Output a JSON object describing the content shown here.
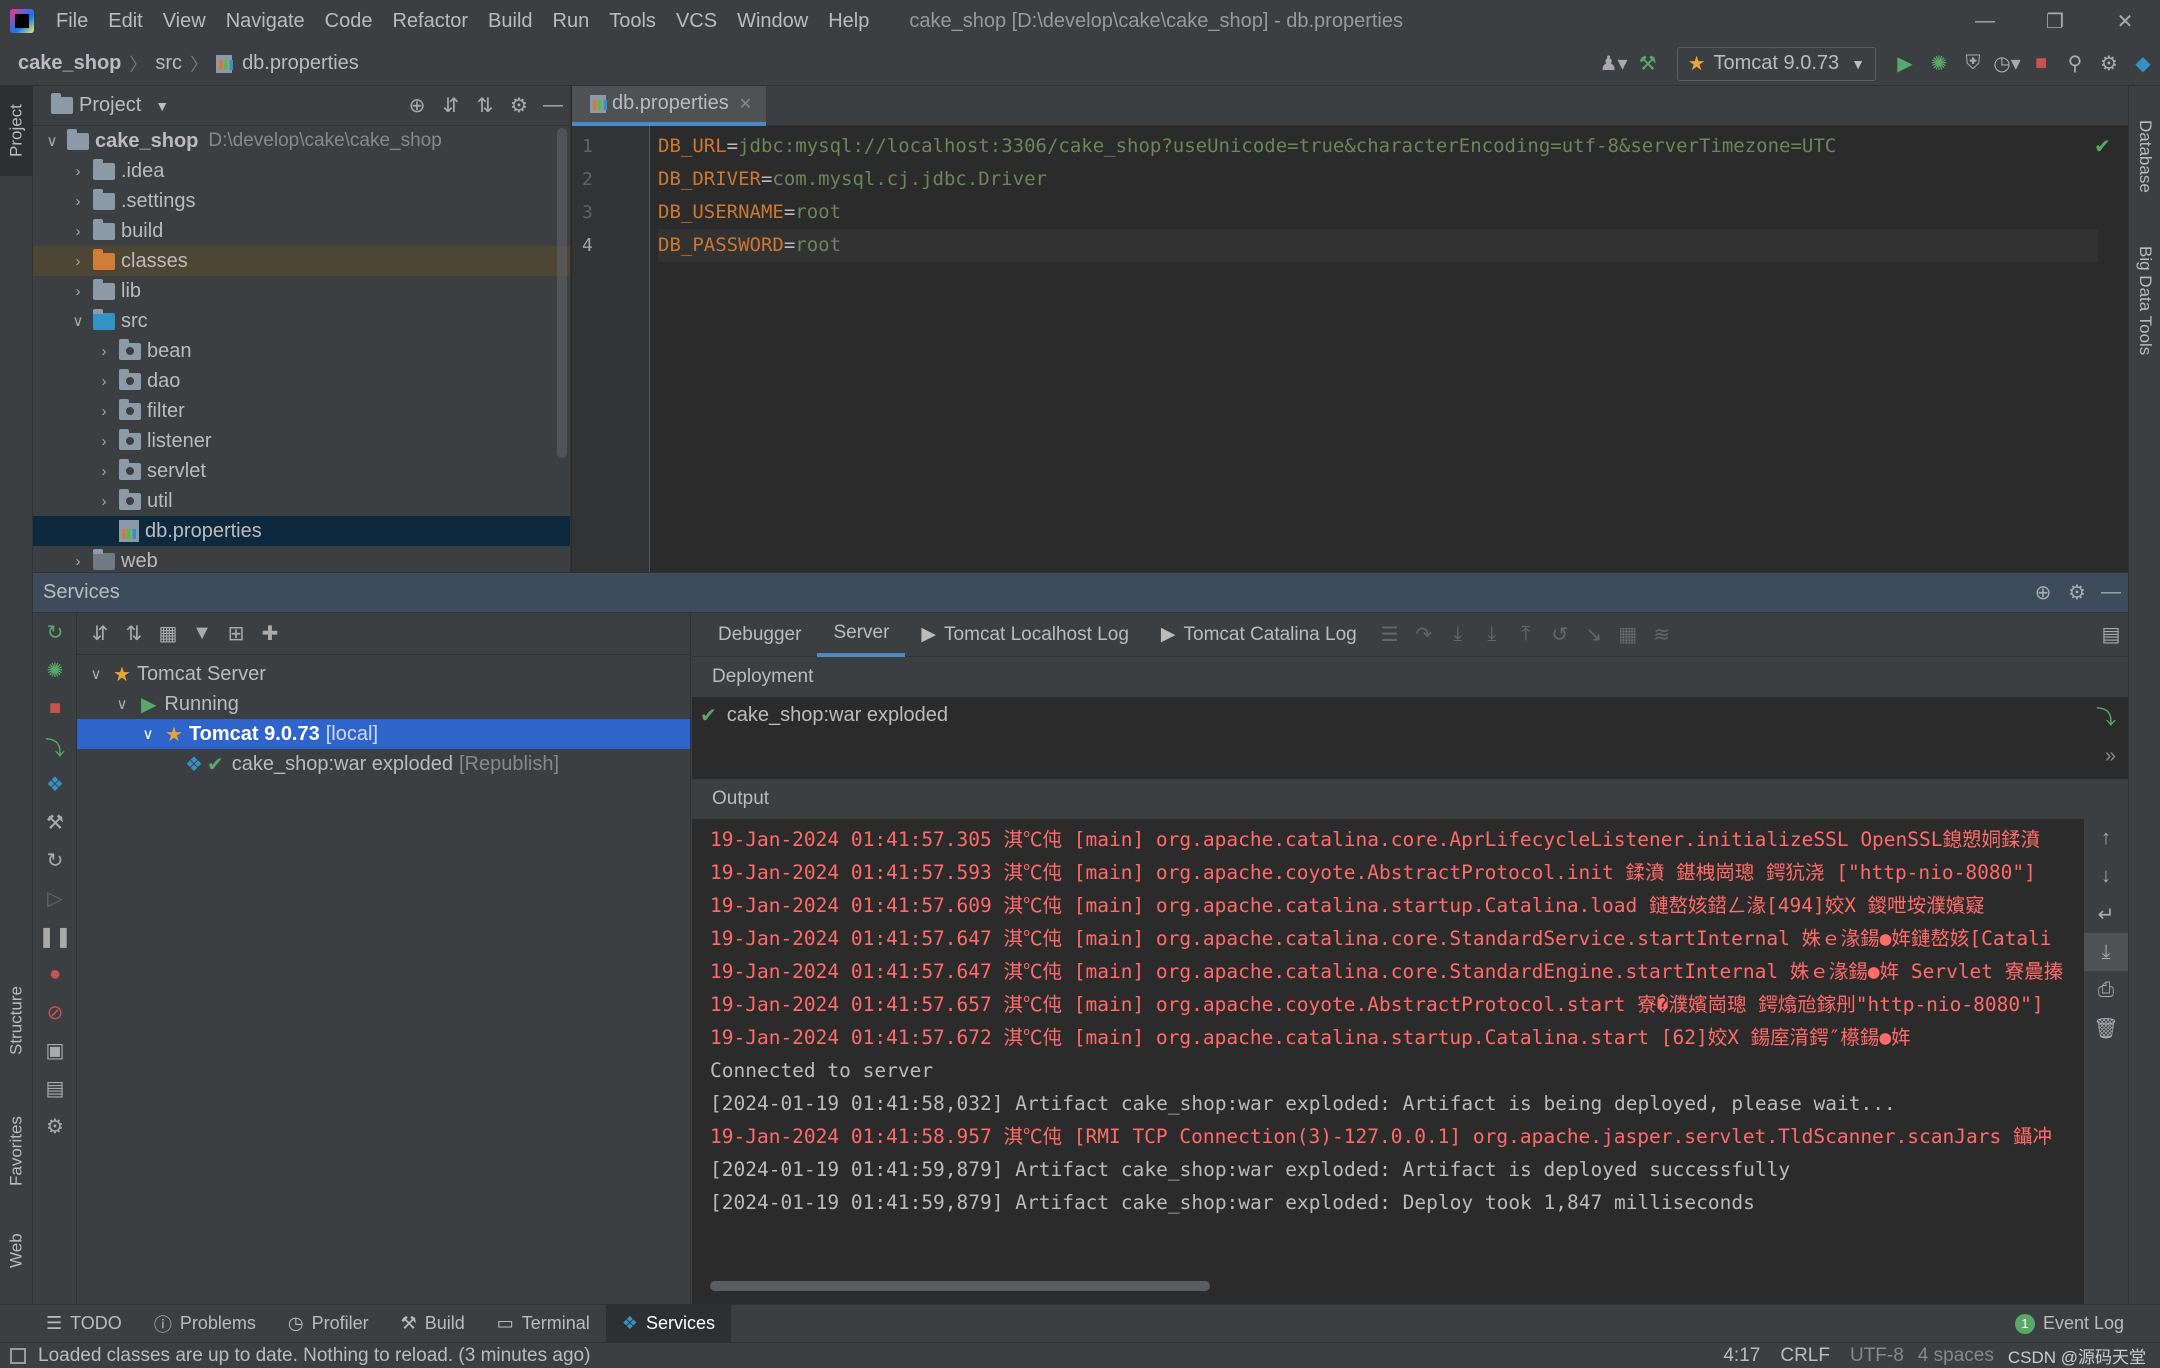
{
  "window": {
    "title": "cake_shop [D:\\develop\\cake\\cake_shop] - db.properties",
    "menu": [
      "File",
      "Edit",
      "View",
      "Navigate",
      "Code",
      "Refactor",
      "Build",
      "Run",
      "Tools",
      "VCS",
      "Window",
      "Help"
    ]
  },
  "navbar": {
    "breadcrumbs": [
      "cake_shop",
      "src",
      "db.properties"
    ],
    "run_config": "Tomcat 9.0.73"
  },
  "project": {
    "header": "Project",
    "tree": [
      {
        "label": "cake_shop",
        "path": "D:\\develop\\cake\\cake_shop"
      },
      {
        "label": ".idea"
      },
      {
        "label": ".settings"
      },
      {
        "label": "build"
      },
      {
        "label": "classes"
      },
      {
        "label": "lib"
      },
      {
        "label": "src"
      },
      {
        "label": "bean"
      },
      {
        "label": "dao"
      },
      {
        "label": "filter"
      },
      {
        "label": "listener"
      },
      {
        "label": "servlet"
      },
      {
        "label": "util"
      },
      {
        "label": "db.properties"
      },
      {
        "label": "web"
      }
    ]
  },
  "editor": {
    "tab": "db.properties",
    "lines": [
      {
        "n": "1",
        "key": "DB_URL",
        "value": "jdbc:mysql://localhost:3306/cake_shop?useUnicode=true&characterEncoding=utf-8&serverTimezone=UTC"
      },
      {
        "n": "2",
        "key": "DB_DRIVER",
        "value": "com.mysql.cj.jdbc.Driver"
      },
      {
        "n": "3",
        "key": "DB_USERNAME",
        "value": "root"
      },
      {
        "n": "4",
        "key": "DB_PASSWORD",
        "value": "root"
      }
    ]
  },
  "stripes": {
    "left": [
      "Project",
      "Structure",
      "Favorites",
      "Web"
    ],
    "right": [
      "Database",
      "Big Data Tools"
    ]
  },
  "services": {
    "title": "Services",
    "tree": {
      "server": "Tomcat Server",
      "running": "Running",
      "instance": "Tomcat 9.0.73",
      "instance_suffix": "[local]",
      "artifact": "cake_shop:war exploded",
      "artifact_suffix": "[Republish]"
    },
    "tabs": [
      "Debugger",
      "Server",
      "Tomcat Localhost Log",
      "Tomcat Catalina Log"
    ],
    "deployment_label": "Deployment",
    "deployment_item": "cake_shop:war exploded",
    "output_label": "Output",
    "log": [
      {
        "type": "err",
        "text": "19-Jan-2024 01:41:57.305 淇℃伅 [main] org.apache.catalina.core.AprLifecycleListener.initializeSSL OpenSSL鎴愬姛鍒濆"
      },
      {
        "type": "err",
        "text": "19-Jan-2024 01:41:57.593 淇℃伅 [main] org.apache.coyote.AbstractProtocol.init 鍒濆 鍖栧崗璁 鍔犺浇 [\"http-nio-8080\"]"
      },
      {
        "type": "err",
        "text": "19-Jan-2024 01:41:57.609 淇℃伅 [main] org.apache.catalina.startup.Catalina.load 鏈嶅姟鍣ㄥ湪[494]姣X 鍐呭垵濮嬪寲"
      },
      {
        "type": "err",
        "text": "19-Jan-2024 01:41:57.647 淇℃伅 [main] org.apache.catalina.core.StandardService.startInternal 姝ｅ湪鍚●姩鏈嶅姟[Catali"
      },
      {
        "type": "err",
        "text": "19-Jan-2024 01:41:57.647 淇℃伅 [main] org.apache.catalina.core.StandardEngine.startInternal 姝ｅ湪鍚●姩 Servlet 寮曟搸"
      },
      {
        "type": "err",
        "text": "19-Jan-2024 01:41:57.657 淇℃伅 [main] org.apache.coyote.AbstractProtocol.start 寮�濮嬪崗璁 鍔熻兘鎵刐\"http-nio-8080\"]"
      },
      {
        "type": "err",
        "text": "19-Jan-2024 01:41:57.672 淇℃伅 [main] org.apache.catalina.startup.Catalina.start [62]姣X 鍚庢湇鍔″櫒鍚●姩"
      },
      {
        "type": "ok",
        "text": "Connected to server"
      },
      {
        "type": "ok",
        "text": "[2024-01-19 01:41:58,032] Artifact cake_shop:war exploded: Artifact is being deployed, please wait..."
      },
      {
        "type": "err",
        "text": "19-Jan-2024 01:41:58.957 淇℃伅 [RMI TCP Connection(3)-127.0.0.1] org.apache.jasper.servlet.TldScanner.scanJars 鑷冲"
      },
      {
        "type": "ok",
        "text": "[2024-01-19 01:41:59,879] Artifact cake_shop:war exploded: Artifact is deployed successfully"
      },
      {
        "type": "ok",
        "text": "[2024-01-19 01:41:59,879] Artifact cake_shop:war exploded: Deploy took 1,847 milliseconds"
      }
    ]
  },
  "bottom_tools": [
    "TODO",
    "Problems",
    "Profiler",
    "Build",
    "Terminal",
    "Services"
  ],
  "event_log": "Event Log",
  "event_log_count": "1",
  "status": {
    "message": "Loaded classes are up to date. Nothing to reload. (3 minutes ago)",
    "position": "4:17",
    "line_sep": "CRLF",
    "encoding": "UTF-8",
    "indent": "4 spaces",
    "watermark": "CSDN @源码天堂"
  },
  "colors": {
    "accent": "#4a88c7",
    "selection": "#2f65ca",
    "error_text": "#ff6b68",
    "keyword": "#cc7832",
    "value": "#6a8759",
    "run_green": "#59a869",
    "stop_red": "#c75450"
  }
}
